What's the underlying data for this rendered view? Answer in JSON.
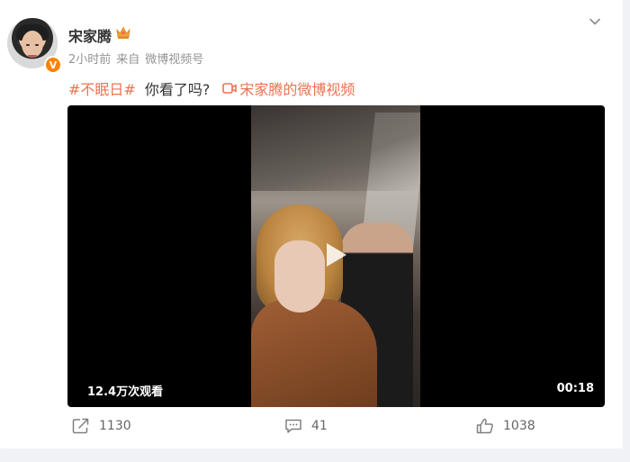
{
  "post": {
    "author": {
      "name": "宋家腾",
      "verified_badge": "V",
      "crown_icon": "crown-icon"
    },
    "meta": {
      "time": "2小时前",
      "source_prefix": "来自",
      "source": "微博视频号"
    },
    "text": {
      "hashtag": "#不眠日#",
      "body": "你看了吗?",
      "video_link": "宋家腾的微博视频"
    },
    "video": {
      "views": "12.4万次观看",
      "duration": "00:18"
    },
    "actions": {
      "share_count": "1130",
      "comment_count": "41",
      "like_count": "1038"
    }
  },
  "colors": {
    "accent": "#eb7350",
    "verified": "#ff8200",
    "crown": "#f0a23a",
    "meta_gray": "#939393"
  }
}
